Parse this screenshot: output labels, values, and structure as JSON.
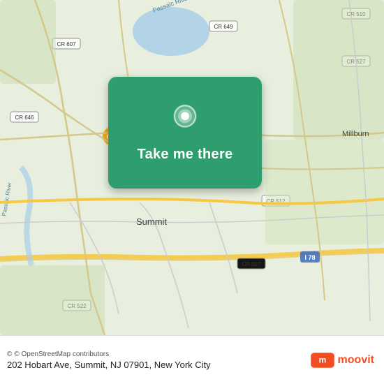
{
  "map": {
    "background_color": "#e8f0e0"
  },
  "card": {
    "button_label": "Take me there",
    "bg_color": "#2e9e6e"
  },
  "bottom_bar": {
    "attribution": "© OpenStreetMap contributors",
    "address": "202 Hobart Ave, Summit, NJ 07901, New York City"
  },
  "icons": {
    "location_pin": "location-pin-icon",
    "moovit_logo": "moovit-logo-icon"
  }
}
